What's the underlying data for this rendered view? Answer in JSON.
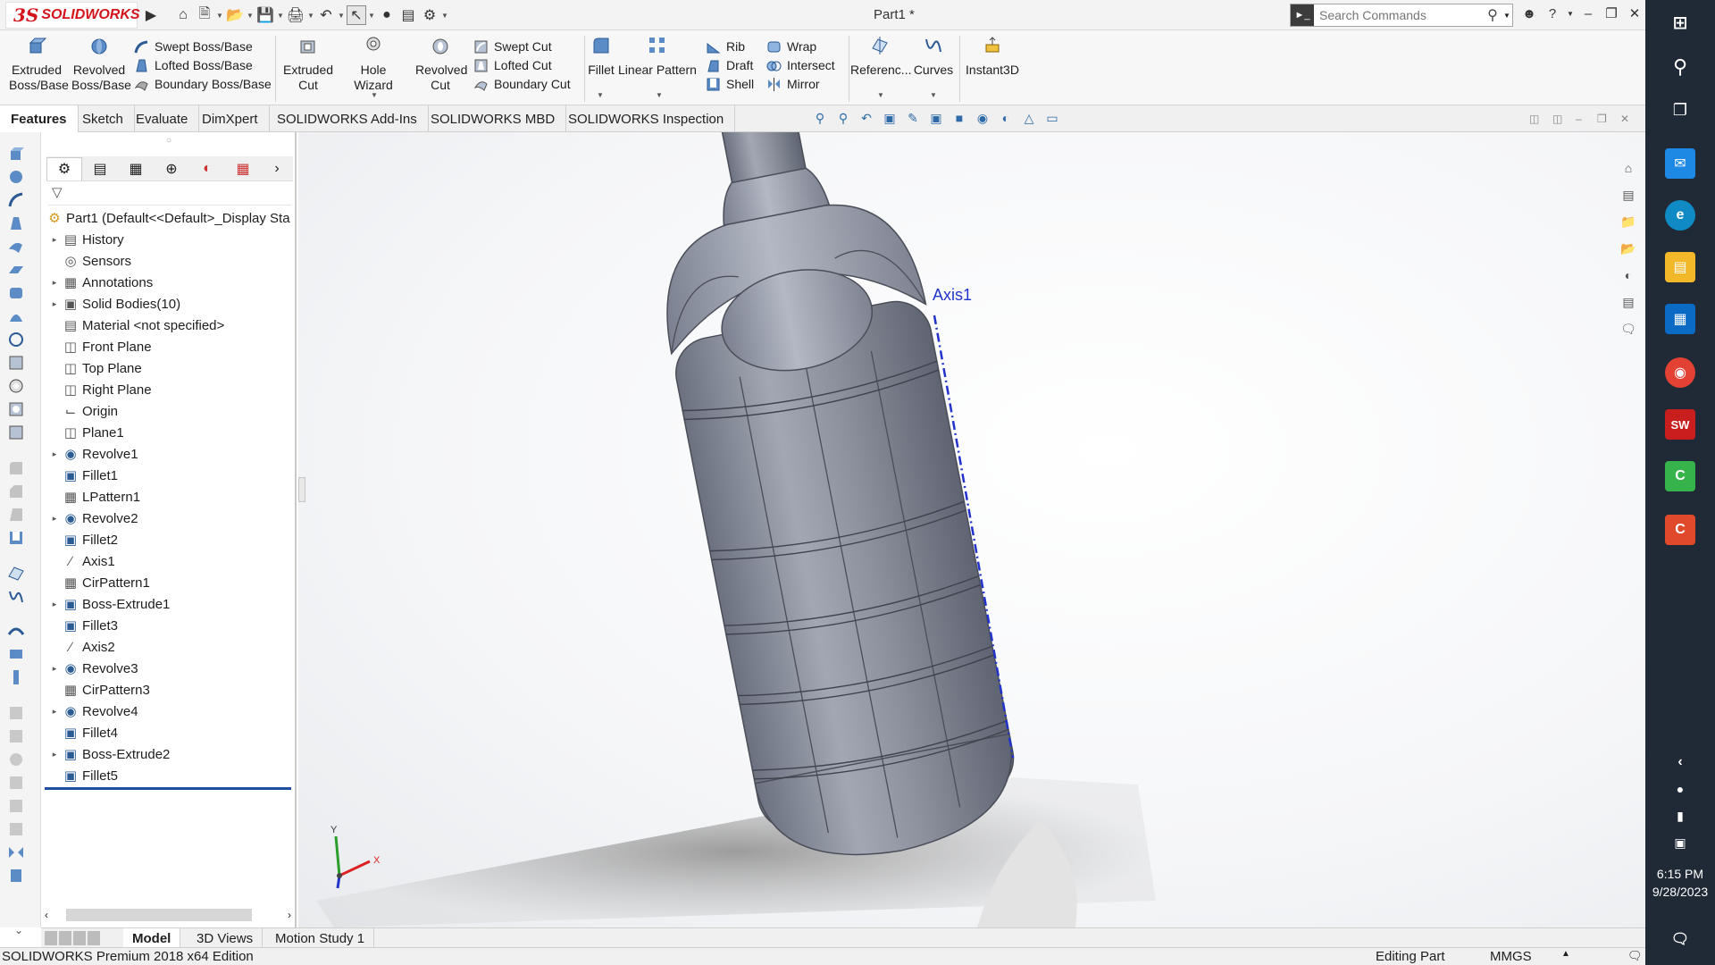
{
  "app": {
    "logo_ds": "3S",
    "logo_text": "SOLIDWORKS",
    "doc_title": "Part1 *",
    "search_placeholder": "Search Commands"
  },
  "toolbar": {
    "extruded_boss": "Extruded Boss/Base",
    "revolved_boss": "Revolved Boss/Base",
    "swept_boss": "Swept Boss/Base",
    "lofted_boss": "Lofted Boss/Base",
    "boundary_boss": "Boundary Boss/Base",
    "extruded_cut": "Extruded Cut",
    "hole_wizard": "Hole Wizard",
    "revolved_cut": "Revolved Cut",
    "swept_cut": "Swept Cut",
    "lofted_cut": "Lofted Cut",
    "boundary_cut": "Boundary Cut",
    "fillet": "Fillet",
    "linear_pattern": "Linear Pattern",
    "rib": "Rib",
    "draft": "Draft",
    "shell": "Shell",
    "wrap": "Wrap",
    "intersect": "Intersect",
    "mirror": "Mirror",
    "reference": "Referenc...",
    "curves": "Curves",
    "instant3d": "Instant3D"
  },
  "tabs": [
    "Features",
    "Sketch",
    "Evaluate",
    "DimXpert",
    "SOLIDWORKS Add-Ins",
    "SOLIDWORKS MBD",
    "SOLIDWORKS Inspection"
  ],
  "tree": {
    "root": "Part1  (Default<<Default>_Display Sta",
    "items": [
      {
        "label": "History",
        "icon": "history-icon",
        "expand": true
      },
      {
        "label": "Sensors",
        "icon": "sensors-icon",
        "expand": false
      },
      {
        "label": "Annotations",
        "icon": "annotations-icon",
        "expand": true
      },
      {
        "label": "Solid Bodies(10)",
        "icon": "solid-bodies-icon",
        "expand": true
      },
      {
        "label": "Material <not specified>",
        "icon": "material-icon",
        "expand": false
      },
      {
        "label": "Front Plane",
        "icon": "plane-icon",
        "expand": false
      },
      {
        "label": "Top Plane",
        "icon": "plane-icon",
        "expand": false
      },
      {
        "label": "Right Plane",
        "icon": "plane-icon",
        "expand": false
      },
      {
        "label": "Origin",
        "icon": "origin-icon",
        "expand": false
      },
      {
        "label": "Plane1",
        "icon": "plane-icon",
        "expand": false
      },
      {
        "label": "Revolve1",
        "icon": "revolve-icon",
        "expand": true
      },
      {
        "label": "Fillet1",
        "icon": "fillet-icon",
        "expand": false
      },
      {
        "label": "LPattern1",
        "icon": "pattern-icon",
        "expand": false
      },
      {
        "label": "Revolve2",
        "icon": "revolve-icon",
        "expand": true
      },
      {
        "label": "Fillet2",
        "icon": "fillet-icon",
        "expand": false
      },
      {
        "label": "Axis1",
        "icon": "axis-icon",
        "expand": false
      },
      {
        "label": "CirPattern1",
        "icon": "pattern-icon",
        "expand": false
      },
      {
        "label": "Boss-Extrude1",
        "icon": "extrude-icon",
        "expand": true
      },
      {
        "label": "Fillet3",
        "icon": "fillet-icon",
        "expand": false
      },
      {
        "label": "Axis2",
        "icon": "axis-icon",
        "expand": false
      },
      {
        "label": "Revolve3",
        "icon": "revolve-icon",
        "expand": true
      },
      {
        "label": "CirPattern3",
        "icon": "pattern-icon",
        "expand": false
      },
      {
        "label": "Revolve4",
        "icon": "revolve-icon",
        "expand": true
      },
      {
        "label": "Fillet4",
        "icon": "fillet-icon",
        "expand": false
      },
      {
        "label": "Boss-Extrude2",
        "icon": "extrude-icon",
        "expand": true
      },
      {
        "label": "Fillet5",
        "icon": "fillet-icon",
        "expand": false
      }
    ]
  },
  "bottom_tabs": [
    "Model",
    "3D Views",
    "Motion Study 1"
  ],
  "status": {
    "edition": "SOLIDWORKS Premium 2018 x64 Edition",
    "mode": "Editing Part",
    "units": "MMGS"
  },
  "viewport": {
    "axis_label": "Axis1",
    "triad_x": "X",
    "triad_y": "Y"
  },
  "clock": {
    "time": "6:15 PM",
    "date": "9/28/2023"
  },
  "colors": {
    "brand": "#d4141c",
    "body": "#8f94a0",
    "axis": "#2233cc"
  }
}
